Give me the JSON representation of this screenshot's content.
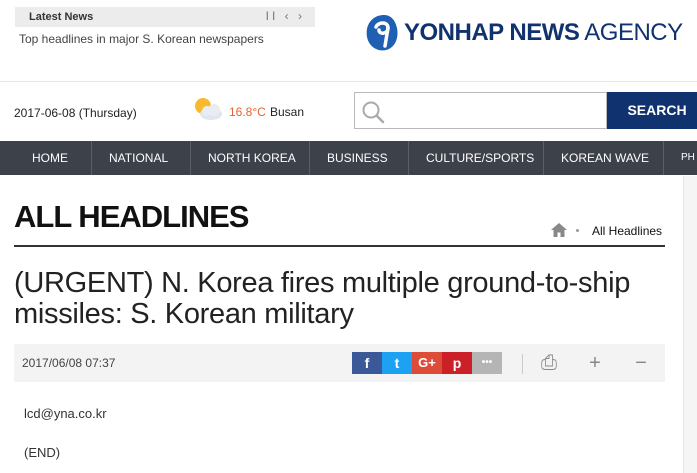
{
  "ticker": {
    "label": "Latest News",
    "controls": "II ‹ ›",
    "headline": "Top headlines in major S. Korean newspapers"
  },
  "logo": {
    "bold": "YONHAP NEWS",
    "light": " AGENCY"
  },
  "info": {
    "date": "2017-06-08 (Thursday)",
    "temperature": "16.8°C",
    "city": "Busan"
  },
  "search": {
    "placeholder": "",
    "button_label": "SEARCH"
  },
  "nav": {
    "items": [
      "HOME",
      "NATIONAL",
      "NORTH KOREA",
      "BUSINESS",
      "CULTURE/SPORTS",
      "KOREAN WAVE",
      "PH"
    ]
  },
  "page": {
    "title": "ALL HEADLINES",
    "breadcrumb_current": "All Headlines"
  },
  "article": {
    "headline": "(URGENT) N. Korea fires multiple ground-to-ship missiles: S. Korean military",
    "timestamp": "2017/06/08 07:37",
    "email": "lcd@yna.co.kr",
    "end": "(END)"
  },
  "share": {
    "facebook": "f",
    "twitter": "t",
    "googleplus": "G+",
    "pinterest": "p",
    "more": "•••",
    "print": "⎙",
    "plus": "+",
    "minus": "−"
  },
  "colors": {
    "brand": "#10326e",
    "nav_bg": "#3d4149",
    "temperature": "#e8622c",
    "facebook": "#3b5998",
    "twitter": "#1da1f2",
    "googleplus": "#dd4b39",
    "pinterest": "#cb2027",
    "more": "#b5b5b5"
  },
  "icons": [
    "pause-icon",
    "prev-arrow-icon",
    "next-arrow-icon",
    "logo-mark-icon",
    "partly-sunny-icon",
    "search-icon",
    "home-icon",
    "print-icon",
    "plus-icon",
    "minus-icon"
  ]
}
